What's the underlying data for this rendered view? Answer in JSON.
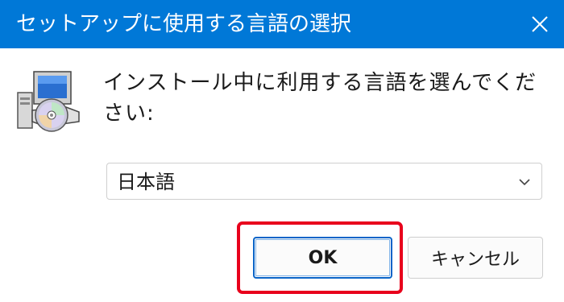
{
  "window": {
    "title": "セットアップに使用する言語の選択",
    "close_icon": "close-icon",
    "titlebar_color": "#0078d7"
  },
  "content": {
    "icon": "setup-installer-icon",
    "prompt": "インストール中に利用する言語を選んでください:",
    "language_select": {
      "selected": "日本語",
      "icon": "chevron-down-icon"
    }
  },
  "buttons": {
    "ok_label": "OK",
    "cancel_label": "キャンセル",
    "highlight_color": "#e8001c"
  }
}
